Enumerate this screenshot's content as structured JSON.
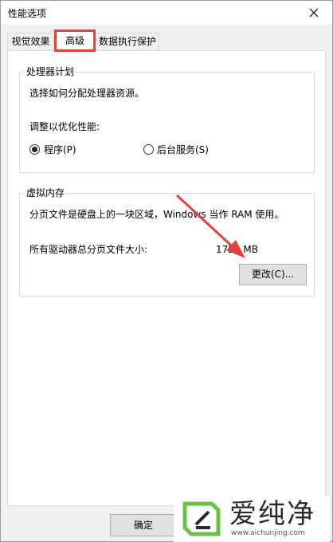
{
  "window": {
    "title": "性能选项"
  },
  "tabs": [
    {
      "label": "视觉效果"
    },
    {
      "label": "高级"
    },
    {
      "label": "数据执行保护"
    }
  ],
  "processor": {
    "group_title": "处理器计划",
    "description": "选择如何分配处理器资源。",
    "adjust_label": "调整以优化性能:",
    "option_programs": "程序(P)",
    "option_services": "后台服务(S)",
    "selected": "程序(P)"
  },
  "virtual_memory": {
    "group_title": "虚拟内存",
    "description": "分页文件是硬盘上的一块区域，Windows 当作 RAM 使用。",
    "total_label": "所有驱动器总分页文件大小:",
    "total_value": "1728 MB",
    "change_button": "更改(C)..."
  },
  "footer": {
    "ok_button": "确定"
  },
  "watermark": {
    "brand": "爱纯净",
    "url": "www.aichunjing.com"
  },
  "colors": {
    "highlight": "#e0443e",
    "arrow": "#e0443e",
    "logo_green": "#6cc04a"
  }
}
